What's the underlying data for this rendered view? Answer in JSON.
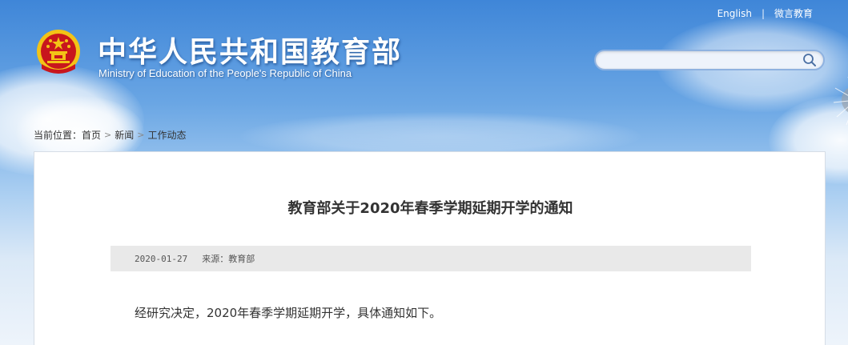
{
  "header": {
    "title": "中华人民共和国教育部",
    "subtitle": "Ministry of Education of the People's Republic of China",
    "links": {
      "english": "English",
      "separator": "|",
      "weibo": "微言教育"
    },
    "search": {
      "placeholder": "",
      "icon": "search-icon"
    },
    "emblem_icon": "national-emblem-icon"
  },
  "breadcrumb": {
    "prefix": "当前位置：",
    "items": [
      "首页",
      "新闻",
      "工作动态"
    ]
  },
  "article": {
    "title": "教育部关于2020年春季学期延期开学的通知",
    "date": "2020-01-27",
    "source_label": "来源：",
    "source": "教育部",
    "body": "经研究决定，2020年春季学期延期开学，具体通知如下。"
  },
  "colors": {
    "sky_top": "#3f86d8",
    "emblem_red": "#c8161d",
    "emblem_gold": "#f3c316",
    "meta_bg": "#e9e9e9"
  }
}
